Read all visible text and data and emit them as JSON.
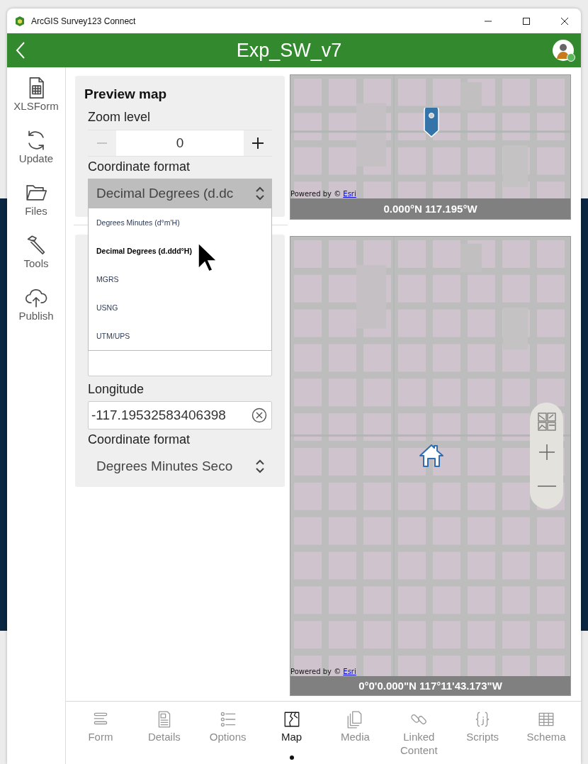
{
  "window": {
    "title": "ArcGIS Survey123 Connect"
  },
  "header": {
    "title": "Exp_SW_v7"
  },
  "sidebar": {
    "items": [
      {
        "label": "XLSForm"
      },
      {
        "label": "Update"
      },
      {
        "label": "Files"
      },
      {
        "label": "Tools"
      },
      {
        "label": "Publish"
      }
    ]
  },
  "preview_map": {
    "title": "Preview map",
    "zoom_label": "Zoom level",
    "zoom_value": "0",
    "zoom_out": {
      "disabled": true
    },
    "zoom_in": {
      "disabled": false
    },
    "format_label": "Coordinate format",
    "format_value": "Decimal Degrees (d.dc",
    "options": [
      {
        "label": "Degrees Minutes (d°m'H)",
        "selected": false
      },
      {
        "label": "Decimal Degrees (d.ddd°H)",
        "selected": true
      },
      {
        "label": "MGRS",
        "selected": false
      },
      {
        "label": "USNG",
        "selected": false
      },
      {
        "label": "UTM/UPS",
        "selected": false
      }
    ]
  },
  "location": {
    "longitude_label": "Longitude",
    "longitude_value": "-117.19532583406398",
    "format_label": "Coordinate format",
    "format_value": "Degrees Minutes Seco"
  },
  "preview_map_view": {
    "attribution": "Powered by ©",
    "attribution_link": "Esri",
    "coordinates": "0.000°N 117.195°W"
  },
  "location_map": {
    "attribution": "Powered by ©",
    "attribution_link": "Esri",
    "coordinates": "0°0'0.000\"N 117°11'43.173\"W"
  },
  "tabs": [
    {
      "label": "Form",
      "selected": false
    },
    {
      "label": "Details",
      "selected": false
    },
    {
      "label": "Options",
      "selected": false
    },
    {
      "label": "Map",
      "selected": true
    },
    {
      "label": "Media",
      "selected": false
    },
    {
      "label": "Linked Content",
      "selected": false
    },
    {
      "label": "Scripts",
      "selected": false
    },
    {
      "label": "Schema",
      "selected": false
    }
  ]
}
